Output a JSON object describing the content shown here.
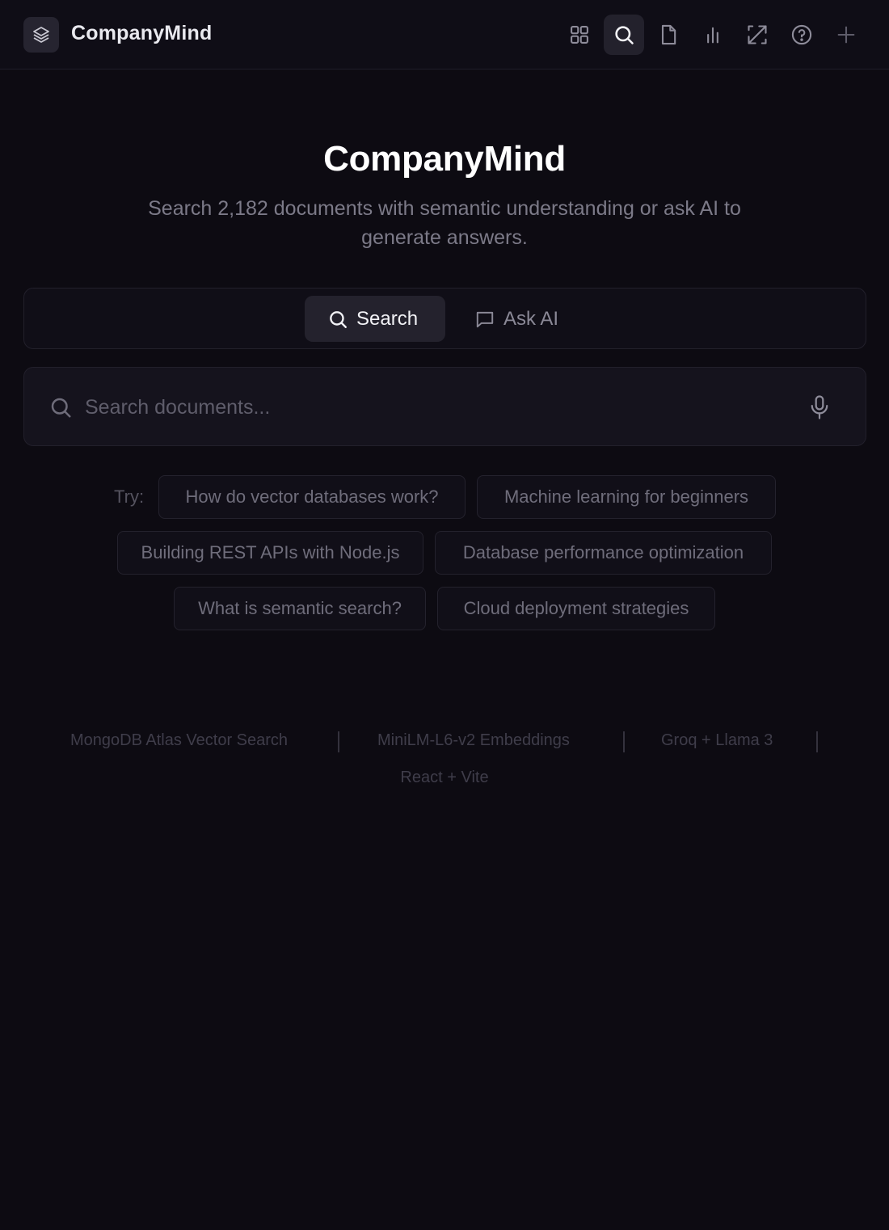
{
  "header": {
    "brand": "CompanyMind",
    "nav": [
      {
        "name": "dashboard",
        "icon": "grid-icon",
        "active": false
      },
      {
        "name": "search",
        "icon": "search-icon",
        "active": true
      },
      {
        "name": "documents",
        "icon": "document-icon",
        "active": false
      },
      {
        "name": "analytics",
        "icon": "bar-chart-icon",
        "active": false
      },
      {
        "name": "expand",
        "icon": "expand-icon",
        "active": false
      },
      {
        "name": "help",
        "icon": "help-circle-icon",
        "active": false
      },
      {
        "name": "add",
        "icon": "plus-icon",
        "active": false
      }
    ]
  },
  "hero": {
    "title": "CompanyMind",
    "subtitle": "Search 2,182 documents with semantic understanding or ask AI to generate answers."
  },
  "mode_tabs": {
    "search_label": "Search",
    "ask_label": "Ask AI",
    "active": "search"
  },
  "search": {
    "placeholder": "Search documents...",
    "value": ""
  },
  "suggestions": {
    "label": "Try:",
    "items": [
      "How do vector databases work?",
      "Machine learning for beginners",
      "Building REST APIs with Node.js",
      "Database performance optimization",
      "What is semantic search?",
      "Cloud deployment strategies"
    ]
  },
  "footer": {
    "tech": [
      "MongoDB Atlas Vector Search",
      "MiniLM-L6-v2 Embeddings",
      "Groq + Llama 3",
      "React + Vite"
    ]
  },
  "colors": {
    "background": "#0d0b12",
    "panel": "#15131d",
    "active_tab": "#24222d",
    "muted_text": "#7c7a88"
  }
}
